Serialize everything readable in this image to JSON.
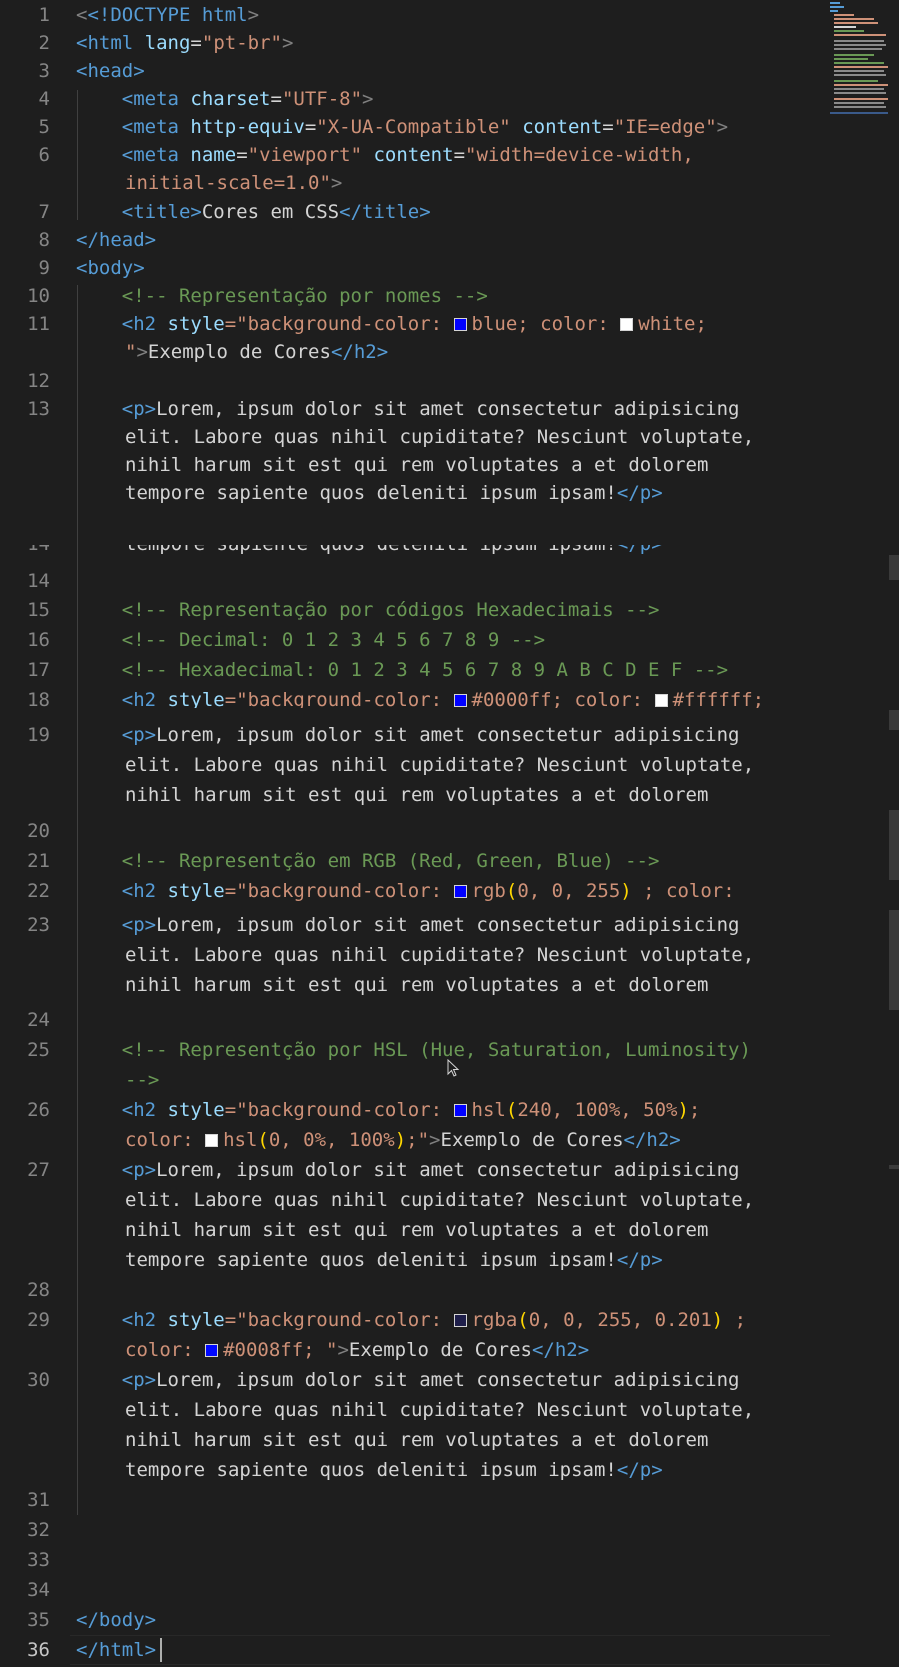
{
  "editor": {
    "colors": {
      "background": "#1e1e1e",
      "tag": "#569cd6",
      "attribute": "#9cdcfe",
      "string": "#ce9178",
      "comment": "#6a9955",
      "text": "#d4d4d4",
      "number": "#b5cea8",
      "paren": "#ffd700",
      "line_number": "#858585"
    },
    "line_numbers": [
      "1",
      "2",
      "3",
      "4",
      "5",
      "6",
      "7",
      "8",
      "9",
      "10",
      "11",
      "12",
      "13",
      "14",
      "14",
      "15",
      "16",
      "17",
      "18",
      "19",
      "20",
      "21",
      "22",
      "23",
      "24",
      "25",
      "26",
      "27",
      "28",
      "29",
      "30",
      "31",
      "32",
      "33",
      "34",
      "35",
      "36"
    ],
    "lines": {
      "l1_doctype": "<!DOCTYPE",
      "l1_html": "html",
      "l1_close": ">",
      "l2_open": "<html",
      "l2_attr": "lang",
      "l2_val": "\"pt-br\"",
      "l2_close": ">",
      "l3": "<head>",
      "l4_tag": "<meta",
      "l4_attr": "charset",
      "l4_val": "\"UTF-8\"",
      "l4_close": ">",
      "l5_tag": "<meta",
      "l5_attr1": "http-equiv",
      "l5_val1": "\"X-UA-Compatible\"",
      "l5_attr2": "content",
      "l5_val2": "\"IE=edge\"",
      "l5_close": ">",
      "l6_tag": "<meta",
      "l6_attr1": "name",
      "l6_val1": "\"viewport\"",
      "l6_attr2": "content",
      "l6_val2a": "\"width=device-width,",
      "l6_val2b": "initial-scale=1.0\"",
      "l6_close": ">",
      "l7_open": "<title>",
      "l7_text": "Cores em CSS",
      "l7_close": "</title>",
      "l8": "</head>",
      "l9": "<body>",
      "l10": "<!-- Representação por nomes -->",
      "l11_tag": "<h2",
      "l11_attr": "style",
      "l11_eq": "=\"background-color: ",
      "l11_v1": "blue; color: ",
      "l11_v2": "white;",
      "l11_b_str": "\"",
      "l11_b_close": ">",
      "l11_b_text": "Exemplo de Cores",
      "l11_b_end": "</h2>",
      "l13_open": "<p>",
      "l13_a": "Lorem, ipsum dolor sit amet consectetur adipisicing",
      "l13_b": "elit. Labore quas nihil cupiditate? Nesciunt voluptate,",
      "l13_c": "nihil harum sit est qui rem voluptates a et dolorem",
      "l13_d": "tempore sapiente quos deleniti ipsum ipsam!",
      "l13_close": "</p>",
      "l15": "<!-- Representação por códigos Hexadecimais -->",
      "l16": "<!-- Decimal: 0 1 2 3 4 5 6 7 8 9 -->",
      "l17": "<!-- Hexadecimal: 0 1 2 3 4 5 6 7 8 9 A B C D E F -->",
      "l18_tag": "<h2",
      "l18_attr": "style",
      "l18_eq": "=\"background-color: ",
      "l18_v1": "#0000ff; color: ",
      "l18_v2": "#ffffff;",
      "l19_open": "<p>",
      "l19_a": "Lorem, ipsum dolor sit amet consectetur adipisicing",
      "l19_b": "elit. Labore quas nihil cupiditate? Nesciunt voluptate,",
      "l19_c": "nihil harum sit est qui rem voluptates a et dolorem",
      "l21": "<!-- Representção em RGB (Red, Green, Blue) -->",
      "l22_tag": "<h2",
      "l22_attr": "style",
      "l22_eq": "=\"background-color: ",
      "l22_fn": "rgb",
      "l22_args": "0, 0, 255",
      "l22_rest": " ; color:",
      "l23_open": "<p>",
      "l23_a": "Lorem, ipsum dolor sit amet consectetur adipisicing",
      "l23_b": "elit. Labore quas nihil cupiditate? Nesciunt voluptate,",
      "l23_c": "nihil harum sit est qui rem voluptates a et dolorem",
      "l25_a": "<!-- Representção por HSL (Hue, Saturation, Luminosity)",
      "l25_b": "-->",
      "l26_tag": "<h2",
      "l26_attr": "style",
      "l26_eq": "=\"background-color: ",
      "l26_fn": "hsl",
      "l26_args": "240, 100%, 50%",
      "l26_semi": ";",
      "l26_b_color": "color: ",
      "l26_b_fn": "hsl",
      "l26_b_args": "0, 0%, 100%",
      "l26_b_end": ";\"",
      "l26_b_close": ">",
      "l26_b_text": "Exemplo de Cores",
      "l26_b_tag": "</h2>",
      "l27_open": "<p>",
      "l27_a": "Lorem, ipsum dolor sit amet consectetur adipisicing",
      "l27_b": "elit. Labore quas nihil cupiditate? Nesciunt voluptate,",
      "l27_c": "nihil harum sit est qui rem voluptates a et dolorem",
      "l27_d": "tempore sapiente quos deleniti ipsum ipsam!",
      "l27_close": "</p>",
      "l29_tag": "<h2",
      "l29_attr": "style",
      "l29_eq": "=\"background-color: ",
      "l29_fn": "rgba",
      "l29_args": "0, 0, 255, 0.201",
      "l29_rest": " ;",
      "l29_b_color": "color: ",
      "l29_b_val": "#0008ff; \"",
      "l29_b_close": ">",
      "l29_b_text": "Exemplo de Cores",
      "l29_b_tag": "</h2>",
      "l30_open": "<p>",
      "l30_a": "Lorem, ipsum dolor sit amet consectetur adipisicing",
      "l30_b": "elit. Labore quas nihil cupiditate? Nesciunt voluptate,",
      "l30_c": "nihil harum sit est qui rem voluptates a et dolorem",
      "l30_d": "tempore sapiente quos deleniti ipsum ipsam!",
      "l30_close": "</p>",
      "l35": "</body>",
      "l36": "</html>"
    },
    "swatches": {
      "blue": "#0000ff",
      "white": "#ffffff",
      "hex_blue": "#0000ff",
      "hex_white": "#ffffff",
      "rgba_light": "#1e1e4a",
      "hex_0008ff": "#0008ff"
    }
  }
}
